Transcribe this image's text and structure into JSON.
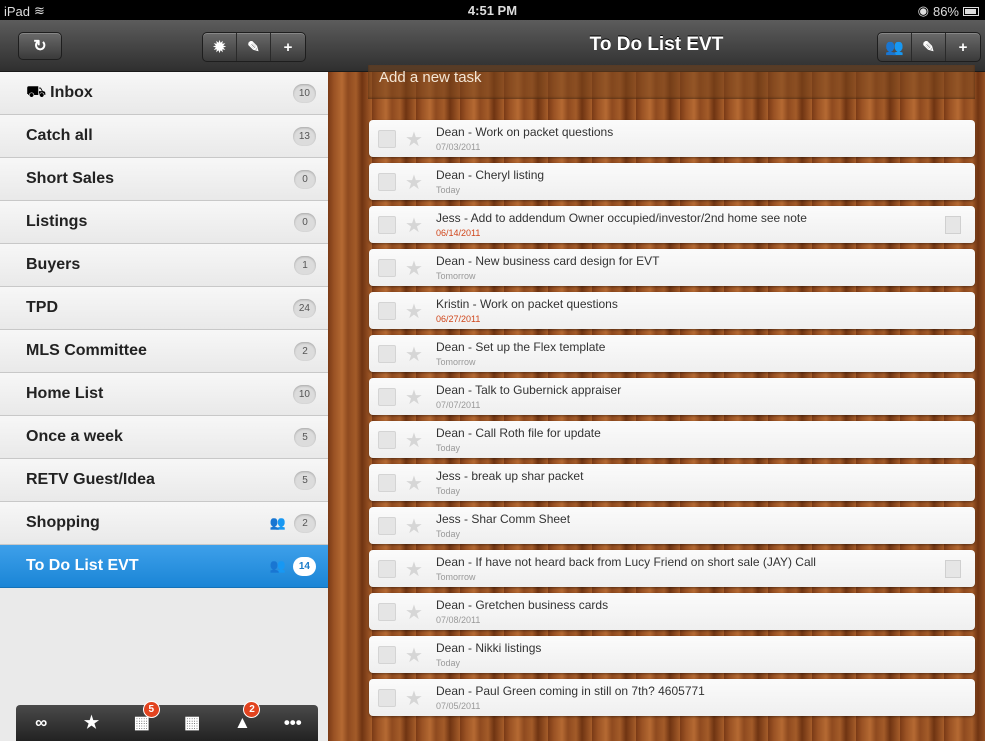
{
  "status_bar": {
    "device": "iPad",
    "time": "4:51 PM",
    "battery": "86%"
  },
  "left_toolbar": {
    "refresh_icon": "refresh-icon",
    "settings_icon": "gear-icon",
    "edit_icon": "pencil-icon",
    "add_icon": "plus-icon"
  },
  "lists": [
    {
      "label": "Inbox",
      "count": "10"
    },
    {
      "label": "Catch all",
      "count": "13"
    },
    {
      "label": "Short Sales",
      "count": "0"
    },
    {
      "label": "Listings",
      "count": "0"
    },
    {
      "label": "Buyers",
      "count": "1"
    },
    {
      "label": "TPD",
      "count": "24"
    },
    {
      "label": "MLS Committee",
      "count": "2"
    },
    {
      "label": "Home List",
      "count": "10"
    },
    {
      "label": "Once a week",
      "count": "5"
    },
    {
      "label": "RETV Guest/Idea",
      "count": "5"
    },
    {
      "label": "Shopping",
      "count": "2"
    },
    {
      "label": "To Do List EVT",
      "count": "14"
    }
  ],
  "bottom_bar": {
    "badge_today": "5",
    "badge_overdue": "2"
  },
  "right": {
    "title": "To Do List EVT",
    "add_task_placeholder": "Add a new task",
    "tasks": [
      {
        "title": "Dean - Work on packet questions",
        "date": "07/03/2011"
      },
      {
        "title": "Dean - Cheryl listing",
        "date": "Today"
      },
      {
        "title": "Jess - Add to addendum Owner occupied/investor/2nd home see note",
        "date": "06/14/2011"
      },
      {
        "title": "Dean - New business card design for EVT",
        "date": "Tomorrow"
      },
      {
        "title": "Kristin - Work on packet questions",
        "date": "06/27/2011"
      },
      {
        "title": "Dean - Set up the Flex template",
        "date": "Tomorrow"
      },
      {
        "title": "Dean - Talk to Gubernick appraiser",
        "date": "07/07/2011"
      },
      {
        "title": "Dean - Call Roth file for update",
        "date": "Today"
      },
      {
        "title": "Jess - break up shar packet",
        "date": "Today"
      },
      {
        "title": "Jess - Shar Comm Sheet",
        "date": "Today"
      },
      {
        "title": "Dean - If have not heard back from Lucy Friend on short sale (JAY) Call",
        "date": "Tomorrow"
      },
      {
        "title": "Dean - Gretchen business cards",
        "date": "07/08/2011"
      },
      {
        "title": "Dean - Nikki listings",
        "date": "Today"
      },
      {
        "title": "Dean - Paul Green coming in still on 7th? 4605771",
        "date": "07/05/2011"
      }
    ]
  },
  "colors": {
    "selected": "#1a85d6",
    "overdue": "#d0461b"
  }
}
